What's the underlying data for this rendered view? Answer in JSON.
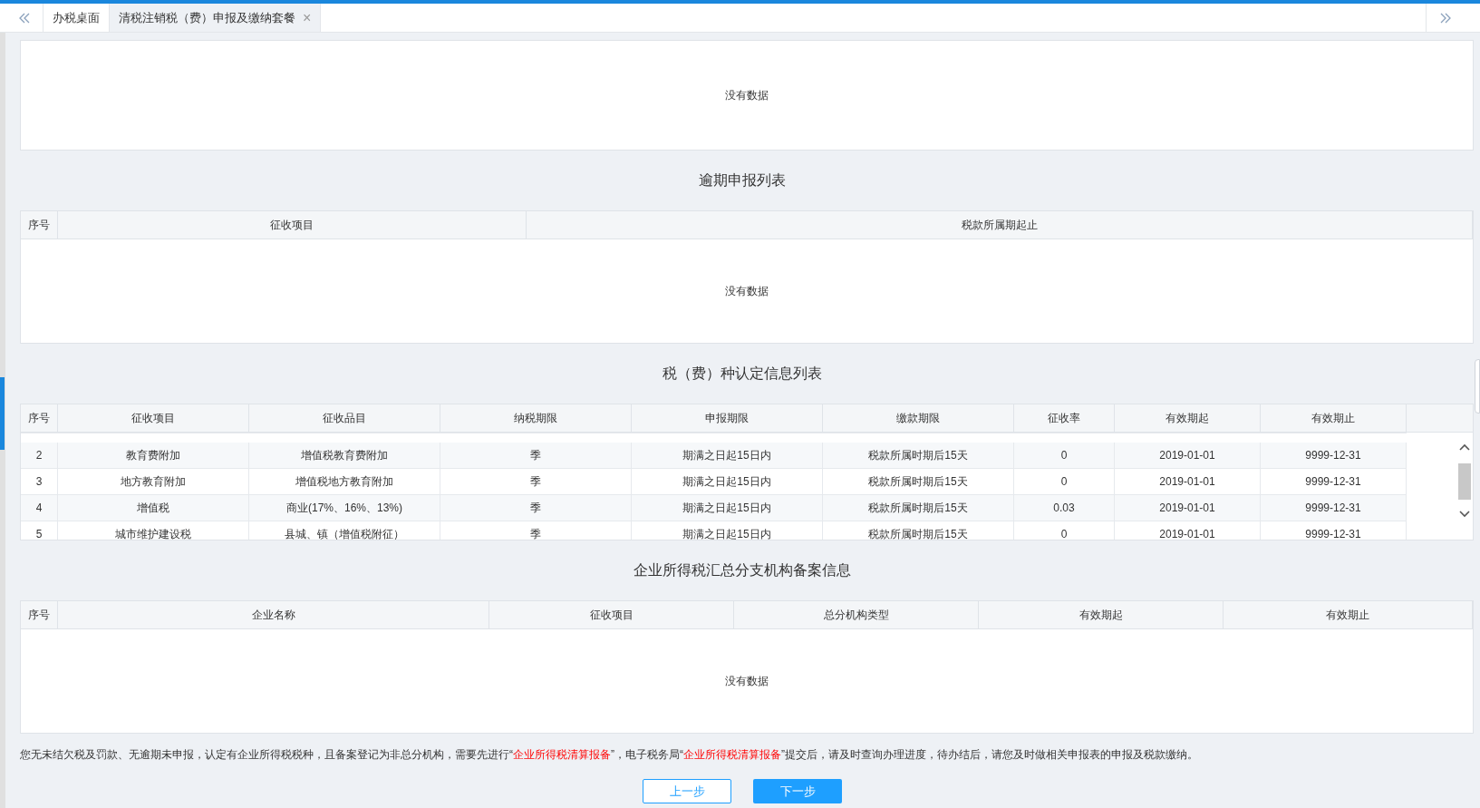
{
  "tabs": [
    {
      "label": "办税桌面",
      "selected": false,
      "closable": false
    },
    {
      "label": "清税注销税（费）申报及缴纳套餐",
      "selected": true,
      "closable": true
    }
  ],
  "tab_close": "×",
  "top_panel": {
    "empty_text": "没有数据"
  },
  "overdue_table": {
    "title": "逾期申报列表",
    "columns": [
      "序号",
      "征收项目",
      "税款所属期起止"
    ],
    "empty_text": "没有数据"
  },
  "tax_types_table": {
    "title": "税（费）种认定信息列表",
    "columns": [
      "序号",
      "征收项目",
      "征收品目",
      "纳税期限",
      "申报期限",
      "缴款期限",
      "征收率",
      "有效期起",
      "有效期止"
    ],
    "rows": [
      [
        "2",
        "教育费附加",
        "增值税教育费附加",
        "季",
        "期满之日起15日内",
        "税款所属时期后15天",
        "0",
        "2019-01-01",
        "9999-12-31"
      ],
      [
        "3",
        "地方教育附加",
        "增值税地方教育附加",
        "季",
        "期满之日起15日内",
        "税款所属时期后15天",
        "0",
        "2019-01-01",
        "9999-12-31"
      ],
      [
        "4",
        "增值税",
        "商业(17%、16%、13%)",
        "季",
        "期满之日起15日内",
        "税款所属时期后15天",
        "0.03",
        "2019-01-01",
        "9999-12-31"
      ],
      [
        "5",
        "城市维护建设税",
        "县城、镇（增值税附征）",
        "季",
        "期满之日起15日内",
        "税款所属时期后15天",
        "0",
        "2019-01-01",
        "9999-12-31"
      ]
    ]
  },
  "branch_table": {
    "title": "企业所得税汇总分支机构备案信息",
    "columns": [
      "序号",
      "企业名称",
      "征收项目",
      "总分机构类型",
      "有效期起",
      "有效期止"
    ],
    "empty_text": "没有数据"
  },
  "notice": [
    {
      "text": "您无未结欠税及罚款、无逾期未申报，认定有企业所得税税种，且备案登记为非总分机构，需要先进行“",
      "highlight": false
    },
    {
      "text": "企业所得税清算报备",
      "highlight": true
    },
    {
      "text": "”，电子税务局“",
      "highlight": false
    },
    {
      "text": "企业所得税清算报备",
      "highlight": true
    },
    {
      "text": "”提交后，请及时查询办理进度，待办结后，请您及时做相关申报表的申报及税款缴纳。",
      "highlight": false
    }
  ],
  "buttons": [
    {
      "label": "上一步",
      "kind": "secondary"
    },
    {
      "label": "下一步",
      "kind": "primary"
    }
  ]
}
